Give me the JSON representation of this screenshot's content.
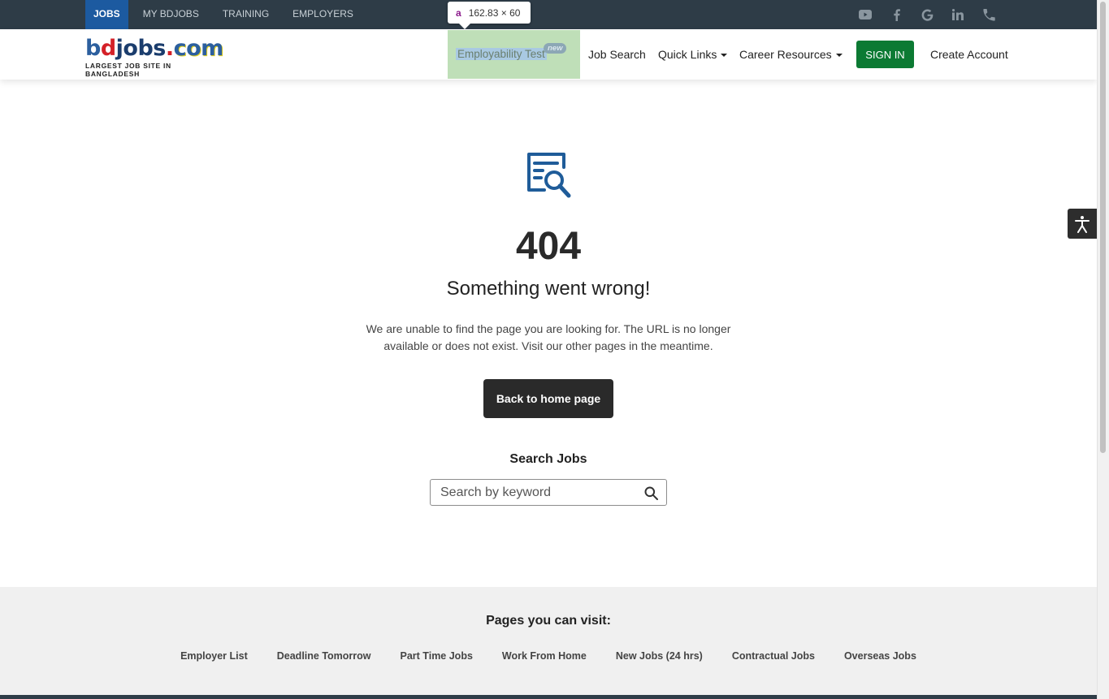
{
  "topnav": {
    "items": [
      {
        "label": "JOBS",
        "active": true
      },
      {
        "label": "MY BDJOBS"
      },
      {
        "label": "TRAINING"
      },
      {
        "label": "EMPLOYERS"
      }
    ],
    "social_icons": [
      "youtube-icon",
      "facebook-icon",
      "google-icon",
      "linkedin-icon",
      "phone-icon"
    ]
  },
  "devtools_tooltip": {
    "tag": "a",
    "size": "162.83 × 60"
  },
  "header": {
    "logo": {
      "word_b": "b",
      "word_d": "d",
      "word_jobs": "jobs",
      "word_dot": ".",
      "word_com": "com",
      "tagline": "LARGEST JOB SITE IN BANGLADESH"
    },
    "nav": {
      "employability": "Employability Test",
      "new_badge": "new",
      "job_search": "Job Search",
      "quick_links": "Quick Links",
      "career_resources": "Career Resources",
      "sign_in": "SIGN IN",
      "create_account": "Create Account"
    }
  },
  "error": {
    "code": "404",
    "title": "Something went wrong!",
    "message": "We are unable to find the page you are looking for. The URL is no longer available or does not exist. Visit our other pages in the meantime.",
    "home_button": "Back to home page"
  },
  "search": {
    "heading": "Search Jobs",
    "placeholder": "Search by keyword"
  },
  "footer": {
    "title": "Pages you can visit:",
    "links": [
      "Employer List",
      "Deadline Tomorrow",
      "Part Time Jobs",
      "Work From Home",
      "New Jobs (24 hrs)",
      "Contractual Jobs",
      "Overseas Jobs"
    ]
  },
  "colors": {
    "topbar": "#2e3c47",
    "active_tab": "#1c5aa0",
    "signin": "#0c7a33",
    "doc_icon": "#1f5c99"
  }
}
